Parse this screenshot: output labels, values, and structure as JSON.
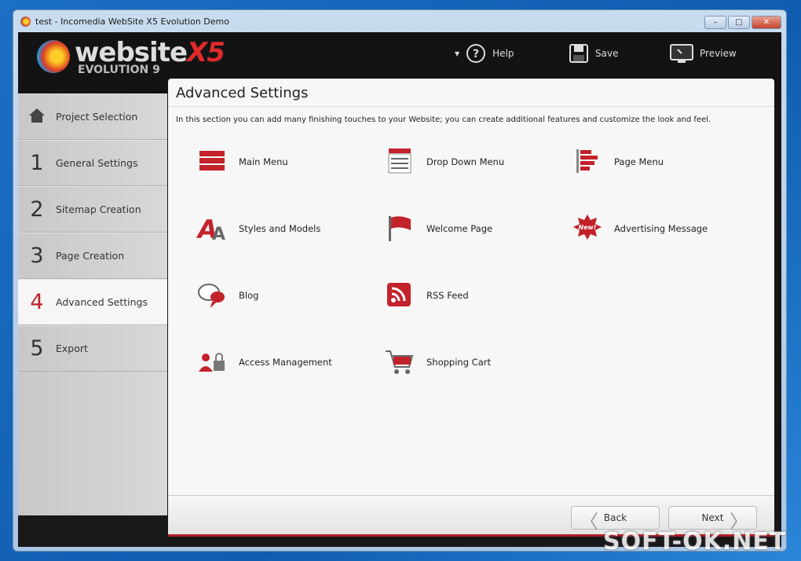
{
  "window": {
    "title": "test - Incomedia WebSite X5 Evolution Demo",
    "minimize": "–",
    "maximize": "□",
    "close": "✕"
  },
  "logo": {
    "word": "website",
    "x5": "X5",
    "edition": "EVOLUTION 9"
  },
  "toolbar": {
    "help": "Help",
    "save": "Save",
    "preview": "Preview"
  },
  "sidebar": {
    "items": [
      {
        "num": "",
        "label": "Project Selection",
        "icon": "home-icon"
      },
      {
        "num": "1",
        "label": "General Settings"
      },
      {
        "num": "2",
        "label": "Sitemap Creation"
      },
      {
        "num": "3",
        "label": "Page Creation"
      },
      {
        "num": "4",
        "label": "Advanced Settings",
        "active": true
      },
      {
        "num": "5",
        "label": "Export"
      }
    ]
  },
  "panel": {
    "title": "Advanced Settings",
    "description": "In this section you can add many finishing touches to your Website; you can create additional features and customize the look and feel.",
    "features": [
      {
        "label": "Main Menu",
        "icon": "main-menu-icon"
      },
      {
        "label": "Drop Down Menu",
        "icon": "drop-down-menu-icon"
      },
      {
        "label": "Page Menu",
        "icon": "page-menu-icon"
      },
      {
        "label": "Styles and Models",
        "icon": "styles-icon"
      },
      {
        "label": "Welcome Page",
        "icon": "flag-icon"
      },
      {
        "label": "Advertising Message",
        "icon": "new-badge-icon",
        "badge": "New!"
      },
      {
        "label": "Blog",
        "icon": "speech-bubbles-icon"
      },
      {
        "label": "RSS Feed",
        "icon": "rss-icon"
      },
      {
        "label": "Access Management",
        "icon": "users-lock-icon"
      },
      {
        "label": "Shopping Cart",
        "icon": "shopping-cart-icon"
      }
    ]
  },
  "footer": {
    "back": "Back",
    "next": "Next"
  },
  "watermark": "SOFT-OK.NET",
  "colors": {
    "accent": "#c3222a",
    "header": "#131313"
  }
}
